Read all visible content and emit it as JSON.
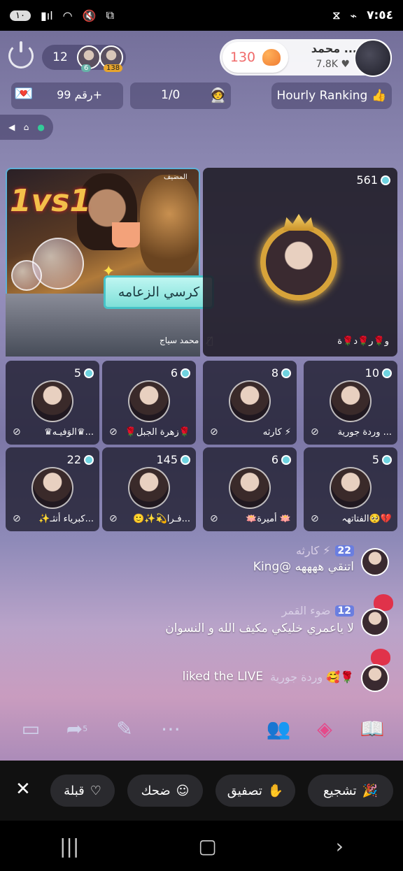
{
  "status_bar": {
    "time": "٧:٥٤",
    "left_badge": "١٠"
  },
  "top_bar": {
    "viewer_count": "12",
    "viewer_badge_1": "6",
    "viewer_badge_2": "138",
    "host_likes": "130",
    "host_name": "محمد ...",
    "host_fans": "7.8K ♥"
  },
  "info_row": {
    "rank_label": "رقم 99+",
    "score": "1/0",
    "hourly_ranking": "Hourly Ranking"
  },
  "host_seat": {
    "tag": "المضيف",
    "banner_text": "1vs1",
    "name": "محمد سياج",
    "chair_label": "كرسي الزعامه"
  },
  "crown_seat": {
    "count": "561",
    "name": "و🌹ر🌹د🌹ة"
  },
  "seats": [
    {
      "count": "5",
      "name": "♛الوَفيـه♛..."
    },
    {
      "count": "6",
      "name": "🌹زهرة الجبل🌹"
    },
    {
      "count": "8",
      "name": "كارثه ⚡"
    },
    {
      "count": "10",
      "name": "وردة جورية ..."
    },
    {
      "count": "22",
      "name": "✨كبرياء أنثـ..."
    },
    {
      "count": "145",
      "name": "🙂✨💫فـرا..."
    },
    {
      "count": "6",
      "name": "🪷أميرة 🪷"
    },
    {
      "count": "5",
      "name": "الفتاتهہ🥺💔"
    }
  ],
  "chat": [
    {
      "name": "كارثه ⚡",
      "level": "22",
      "message": "King@ اتنقي ههههه"
    },
    {
      "name": "ضوء القمر",
      "level": "12",
      "message": "لا ياعمري خليكي مكيف    الله و النسوان"
    },
    {
      "name": "وردة جورية 🥰🌹",
      "message": "liked the LIVE"
    }
  ],
  "toolbar": {
    "share_count": "5"
  },
  "reactions": {
    "kiss": "قبلة",
    "laugh": "ضحك",
    "clap": "تصفيق",
    "cheer": "تشجيع"
  }
}
